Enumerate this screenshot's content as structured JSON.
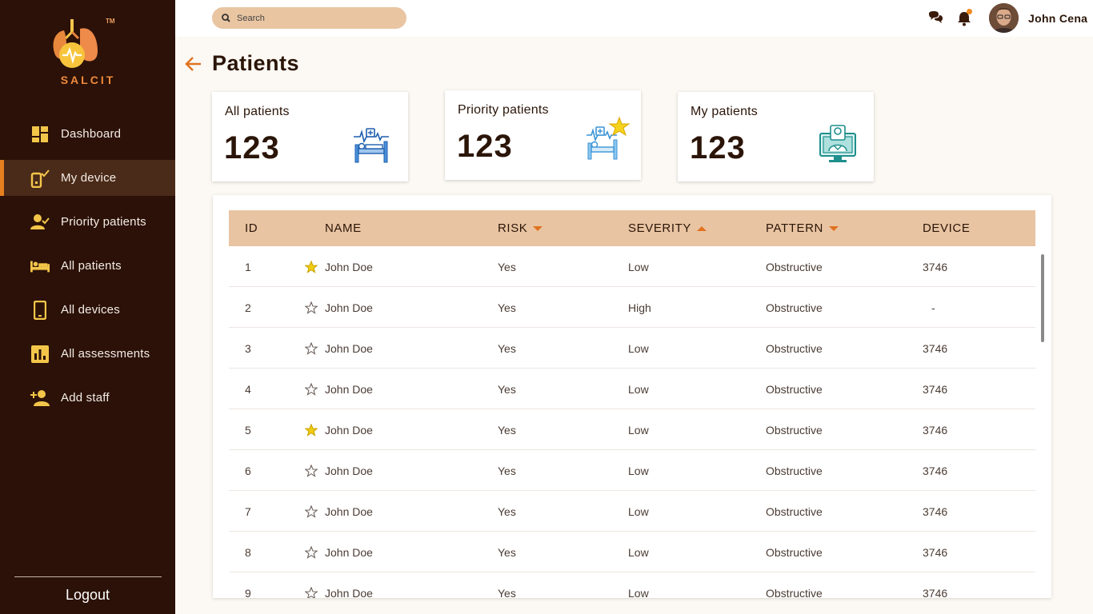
{
  "app": {
    "name": "SALCIT",
    "trademark": "TM"
  },
  "colors": {
    "sidebar_bg": "#2b1107",
    "accent": "#e6801f",
    "table_header_bg": "#e8c4a2",
    "star_active": "#f2cc10"
  },
  "sidebar": {
    "items": [
      {
        "label": "Dashboard",
        "icon": "dashboard-icon"
      },
      {
        "label": "My device",
        "icon": "device-check-icon",
        "active": true
      },
      {
        "label": "Priority patients",
        "icon": "user-check-icon"
      },
      {
        "label": "All patients",
        "icon": "bed-icon"
      },
      {
        "label": "All devices",
        "icon": "phone-icon"
      },
      {
        "label": "All assessments",
        "icon": "bar-chart-icon"
      },
      {
        "label": "Add staff",
        "icon": "add-person-icon"
      }
    ],
    "logout": "Logout"
  },
  "topbar": {
    "search_placeholder": "Search",
    "user_name": "John Cena",
    "has_notification": true
  },
  "page": {
    "title": "Patients"
  },
  "cards": [
    {
      "label": "All patients",
      "count": "123",
      "icon": "hospital-bed-icon"
    },
    {
      "label": "Priority patients",
      "count": "123",
      "icon": "priority-bed-star-icon"
    },
    {
      "label": "My patients",
      "count": "123",
      "icon": "doctor-monitor-icon"
    }
  ],
  "table": {
    "columns": {
      "id": "ID",
      "name": "NAME",
      "risk": "RISK",
      "severity": "SEVERITY",
      "pattern": "PATTERN",
      "device": "DEVICE"
    },
    "sort": {
      "risk": "desc",
      "severity": "asc",
      "pattern": "desc"
    },
    "rows": [
      {
        "id": "1",
        "starred": true,
        "name": "John Doe",
        "risk": "Yes",
        "severity": "Low",
        "pattern": "Obstructive",
        "device": "3746"
      },
      {
        "id": "2",
        "starred": false,
        "name": "John Doe",
        "risk": "Yes",
        "severity": "High",
        "pattern": "Obstructive",
        "device": "-"
      },
      {
        "id": "3",
        "starred": false,
        "name": "John Doe",
        "risk": "Yes",
        "severity": "Low",
        "pattern": "Obstructive",
        "device": "3746"
      },
      {
        "id": "4",
        "starred": false,
        "name": "John Doe",
        "risk": "Yes",
        "severity": "Low",
        "pattern": "Obstructive",
        "device": "3746"
      },
      {
        "id": "5",
        "starred": true,
        "name": "John Doe",
        "risk": "Yes",
        "severity": "Low",
        "pattern": "Obstructive",
        "device": "3746"
      },
      {
        "id": "6",
        "starred": false,
        "name": "John Doe",
        "risk": "Yes",
        "severity": "Low",
        "pattern": "Obstructive",
        "device": "3746"
      },
      {
        "id": "7",
        "starred": false,
        "name": "John Doe",
        "risk": "Yes",
        "severity": "Low",
        "pattern": "Obstructive",
        "device": "3746"
      },
      {
        "id": "8",
        "starred": false,
        "name": "John Doe",
        "risk": "Yes",
        "severity": "Low",
        "pattern": "Obstructive",
        "device": "3746"
      },
      {
        "id": "9",
        "starred": false,
        "name": "John Doe",
        "risk": "Yes",
        "severity": "Low",
        "pattern": "Obstructive",
        "device": "3746"
      }
    ]
  }
}
